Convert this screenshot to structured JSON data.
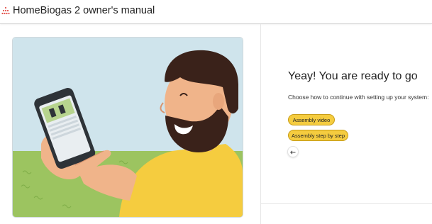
{
  "header": {
    "title": "HomeBiogas 2 owner's manual",
    "logo_icon": "homebiogas-logo-icon"
  },
  "main": {
    "heading": "Yeay! You are ready to go",
    "subtext": "Choose how to continue with setting up your system:",
    "buttons": [
      {
        "label": "Assembly video"
      },
      {
        "label": "Assembly step by step"
      }
    ],
    "back_icon": "arrow-left-icon"
  },
  "colors": {
    "accent": "#f5cc3f",
    "brand": "#2e9e5b",
    "sky": "#cfe4ec",
    "grass": "#9cc460"
  }
}
